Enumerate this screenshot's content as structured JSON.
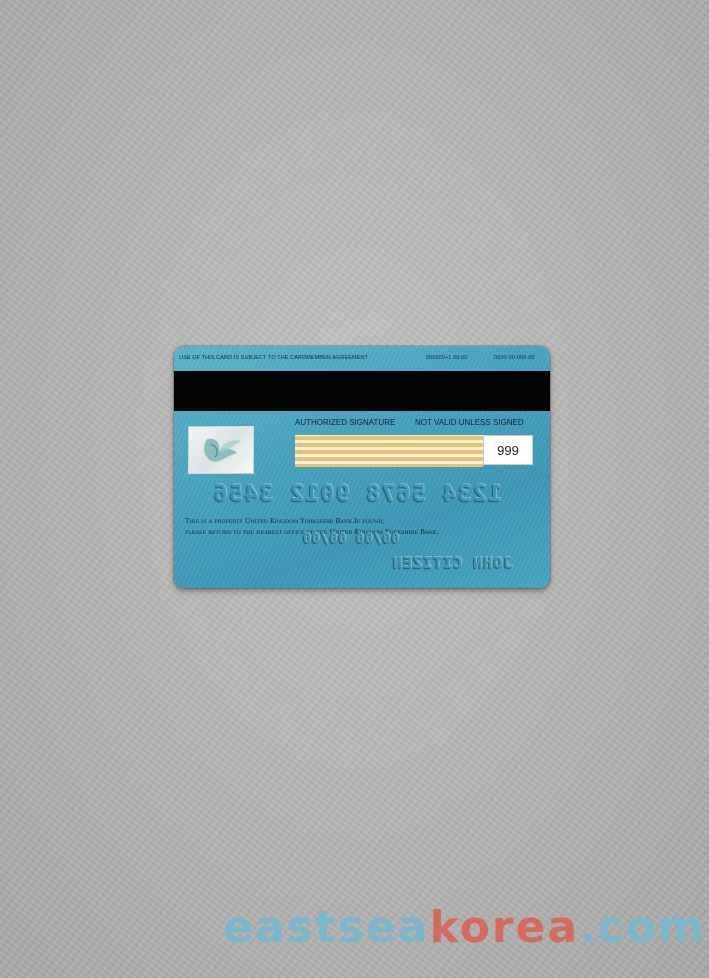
{
  "card": {
    "agreement_text": "USE OF THIS CARD IS SUBJECT TO THE CARDMEMBER AGREEMENT",
    "code_1": "000000+1 00:00",
    "code_2": "0000-00-000-00",
    "authorized_signature": "AUTHORIZED SIGNATURE",
    "not_valid": "NOT VALID UNLESS SIGNED",
    "cvv": "999",
    "card_number": "1234 5678 9012 3456",
    "property_line_1": "This is a property United Kingdom Yorkshire Bank.If found,",
    "property_line_2": "please return to the nearest office of the United Kingdom Yorkshire Bank.",
    "dates": "00/00  00/00",
    "holder_name": "JOHN CITIZEN",
    "colors": {
      "card": "#4aa6c2",
      "stripe": "#050505",
      "signature_gold": "#e8c46e"
    }
  },
  "watermark": {
    "part_1": "eastsea",
    "part_2": "korea",
    "part_3": ".com",
    "colors": {
      "blue": "#7ab6cc",
      "red": "#d56a5e"
    }
  }
}
